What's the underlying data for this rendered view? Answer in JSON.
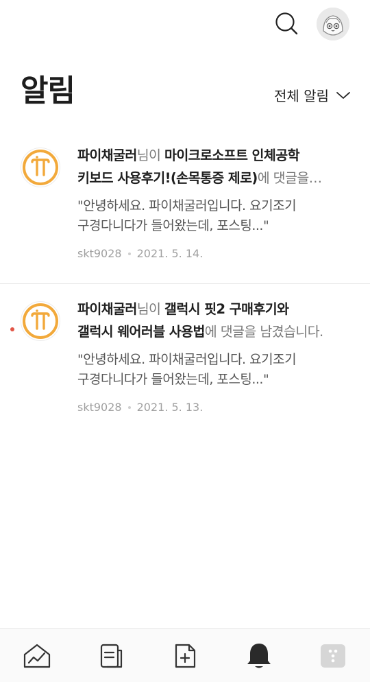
{
  "header": {
    "search_icon": "search-icon",
    "avatar_icon": "profile-avatar"
  },
  "page": {
    "title": "알림",
    "filter_label": "전체 알림"
  },
  "notifications": [
    {
      "unread": false,
      "sender": "파이채굴러",
      "headline_line1_suffix": "님이 ",
      "headline_line1_post": "마이크로소프트 인체공학",
      "headline_line2_post": "키보드 사용후기!(손목통증 제로)",
      "headline_line2_tail": "에 댓글을…",
      "excerpt_line1": "\"안녕하세요. 파이채굴러입니다. 요기조기",
      "excerpt_line2": "구경다니다가 들어왔는데, 포스팅...\"",
      "author": "skt9028",
      "date": "2021. 5. 14."
    },
    {
      "unread": true,
      "sender": "파이채굴러",
      "headline_line1_suffix": "님이 ",
      "headline_line1_post": "갤럭시 핏2 구매후기와",
      "headline_line2_post": "갤럭시 웨어러블 사용법",
      "headline_line2_tail": "에 댓글을 남겼습니다.",
      "excerpt_line1": "\"안녕하세요. 파이채굴러입니다. 요기조기",
      "excerpt_line2": "구경다니다가 들어왔는데, 포스팅...\"",
      "author": "skt9028",
      "date": "2021. 5. 13."
    }
  ],
  "bottom_nav": {
    "items": [
      "stats-icon",
      "post-list-icon",
      "new-post-icon",
      "bell-icon",
      "more-icon"
    ]
  },
  "colors": {
    "accent_logo": "#f2a93b",
    "unread_dot": "#e25546",
    "text_primary": "#1f1f1f",
    "text_secondary": "#7a7a7a"
  }
}
